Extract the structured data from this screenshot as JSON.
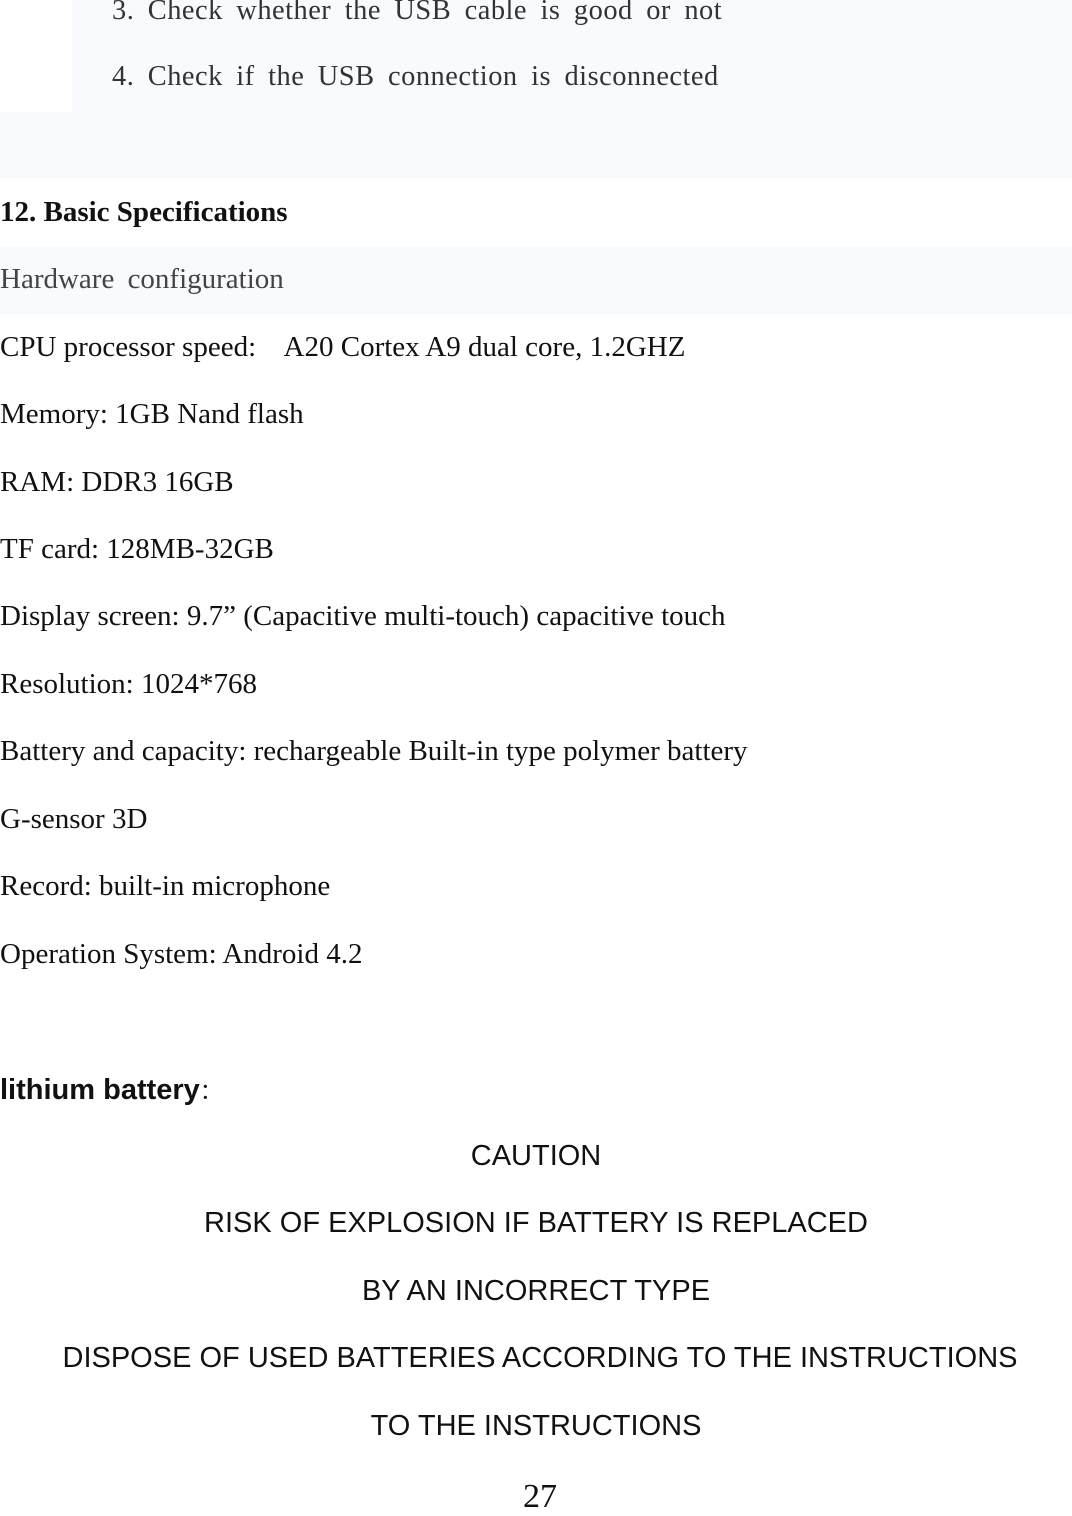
{
  "troubleshooting_steps": [
    "3.  Check  whether  the  USB  cable  is  good  or  not",
    "4.  Check  if  the  USB  connection  is  disconnected"
  ],
  "section": {
    "heading": "12. Basic Specifications",
    "subheading": "Hardware  configuration"
  },
  "specs": [
    "CPU processor speed:    A20 Cortex A9 dual core, 1.2GHZ",
    "Memory: 1GB Nand flash",
    "RAM: DDR3 16GB",
    "TF card: 128MB-32GB",
    "Display screen: 9.7” (Capacitive multi-touch) capacitive touch",
    "Resolution: 1024*768",
    "Battery and capacity: rechargeable Built-in type polymer battery",
    "G-sensor 3D",
    "Record: built-in microphone",
    "Operation System: Android 4.2"
  ],
  "battery": {
    "label": "lithium battery",
    "colon": "：",
    "caution_lines": [
      "CAUTION",
      "RISK OF EXPLOSION IF BATTERY IS REPLACED",
      "BY AN INCORRECT TYPE",
      "DISPOSE OF USED BATTERIES ACCORDING TO THE INSTRUCTIONS",
      "TO THE INSTRUCTIONS"
    ]
  },
  "page_number": "27"
}
